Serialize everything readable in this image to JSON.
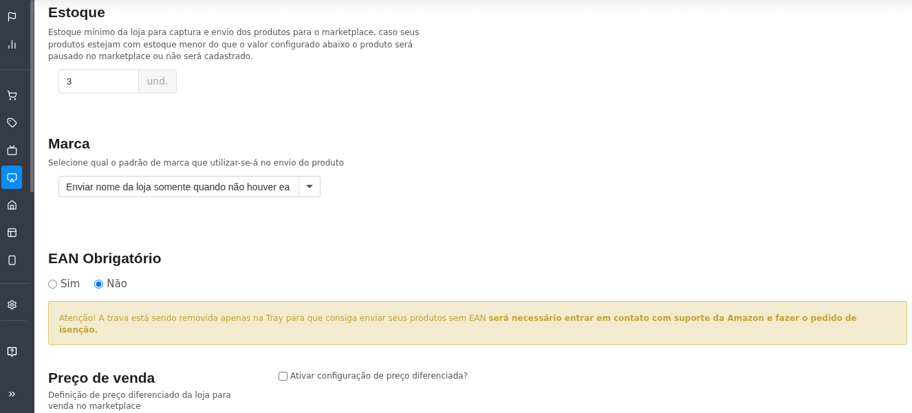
{
  "sidebar": {
    "groups": [
      {
        "items": [
          {
            "selected": false
          },
          {
            "selected": false
          }
        ]
      },
      {
        "items": [
          {
            "selected": false
          },
          {
            "selected": false
          },
          {
            "selected": false
          },
          {
            "selected": true
          },
          {
            "selected": false
          },
          {
            "selected": false
          },
          {
            "selected": false
          }
        ]
      },
      {
        "items": [
          {
            "selected": false
          }
        ]
      },
      {
        "items": [
          {
            "selected": false
          }
        ]
      }
    ]
  },
  "estoque": {
    "title": "Estoque",
    "description": "Estoque mínimo da loja para captura e envio dos produtos para o marketplace, caso seus produtos estejam com estoque menor do que o valor configurado abaixo o produto será pausado no marketplace ou não será cadastrado.",
    "input": {
      "value": "3",
      "unit": "und."
    }
  },
  "marca": {
    "title": "Marca",
    "description": "Selecione qual o padrão de marca que utilizar-se-á no envio do produto",
    "select": {
      "value": "Enviar nome da loja somente quando não houver ea"
    }
  },
  "ean": {
    "title": "EAN Obrigatório",
    "options": [
      {
        "label": "Sim",
        "selected": false
      },
      {
        "label": "Não",
        "selected": true
      }
    ],
    "alert": "Atenção! A trava está sendo removida apenas na Tray para que consiga enviar seus produtos sem EAN **será necessário entrar em contato com suporte da Amazon e fazer o pedido de isenção.**"
  },
  "preco": {
    "title": "Preço de venda",
    "description": "Definição de preço diferenciado da loja para venda no marketplace",
    "checkbox": {
      "label": "Ativar configuração de preço diferenciada?",
      "checked": false
    }
  }
}
